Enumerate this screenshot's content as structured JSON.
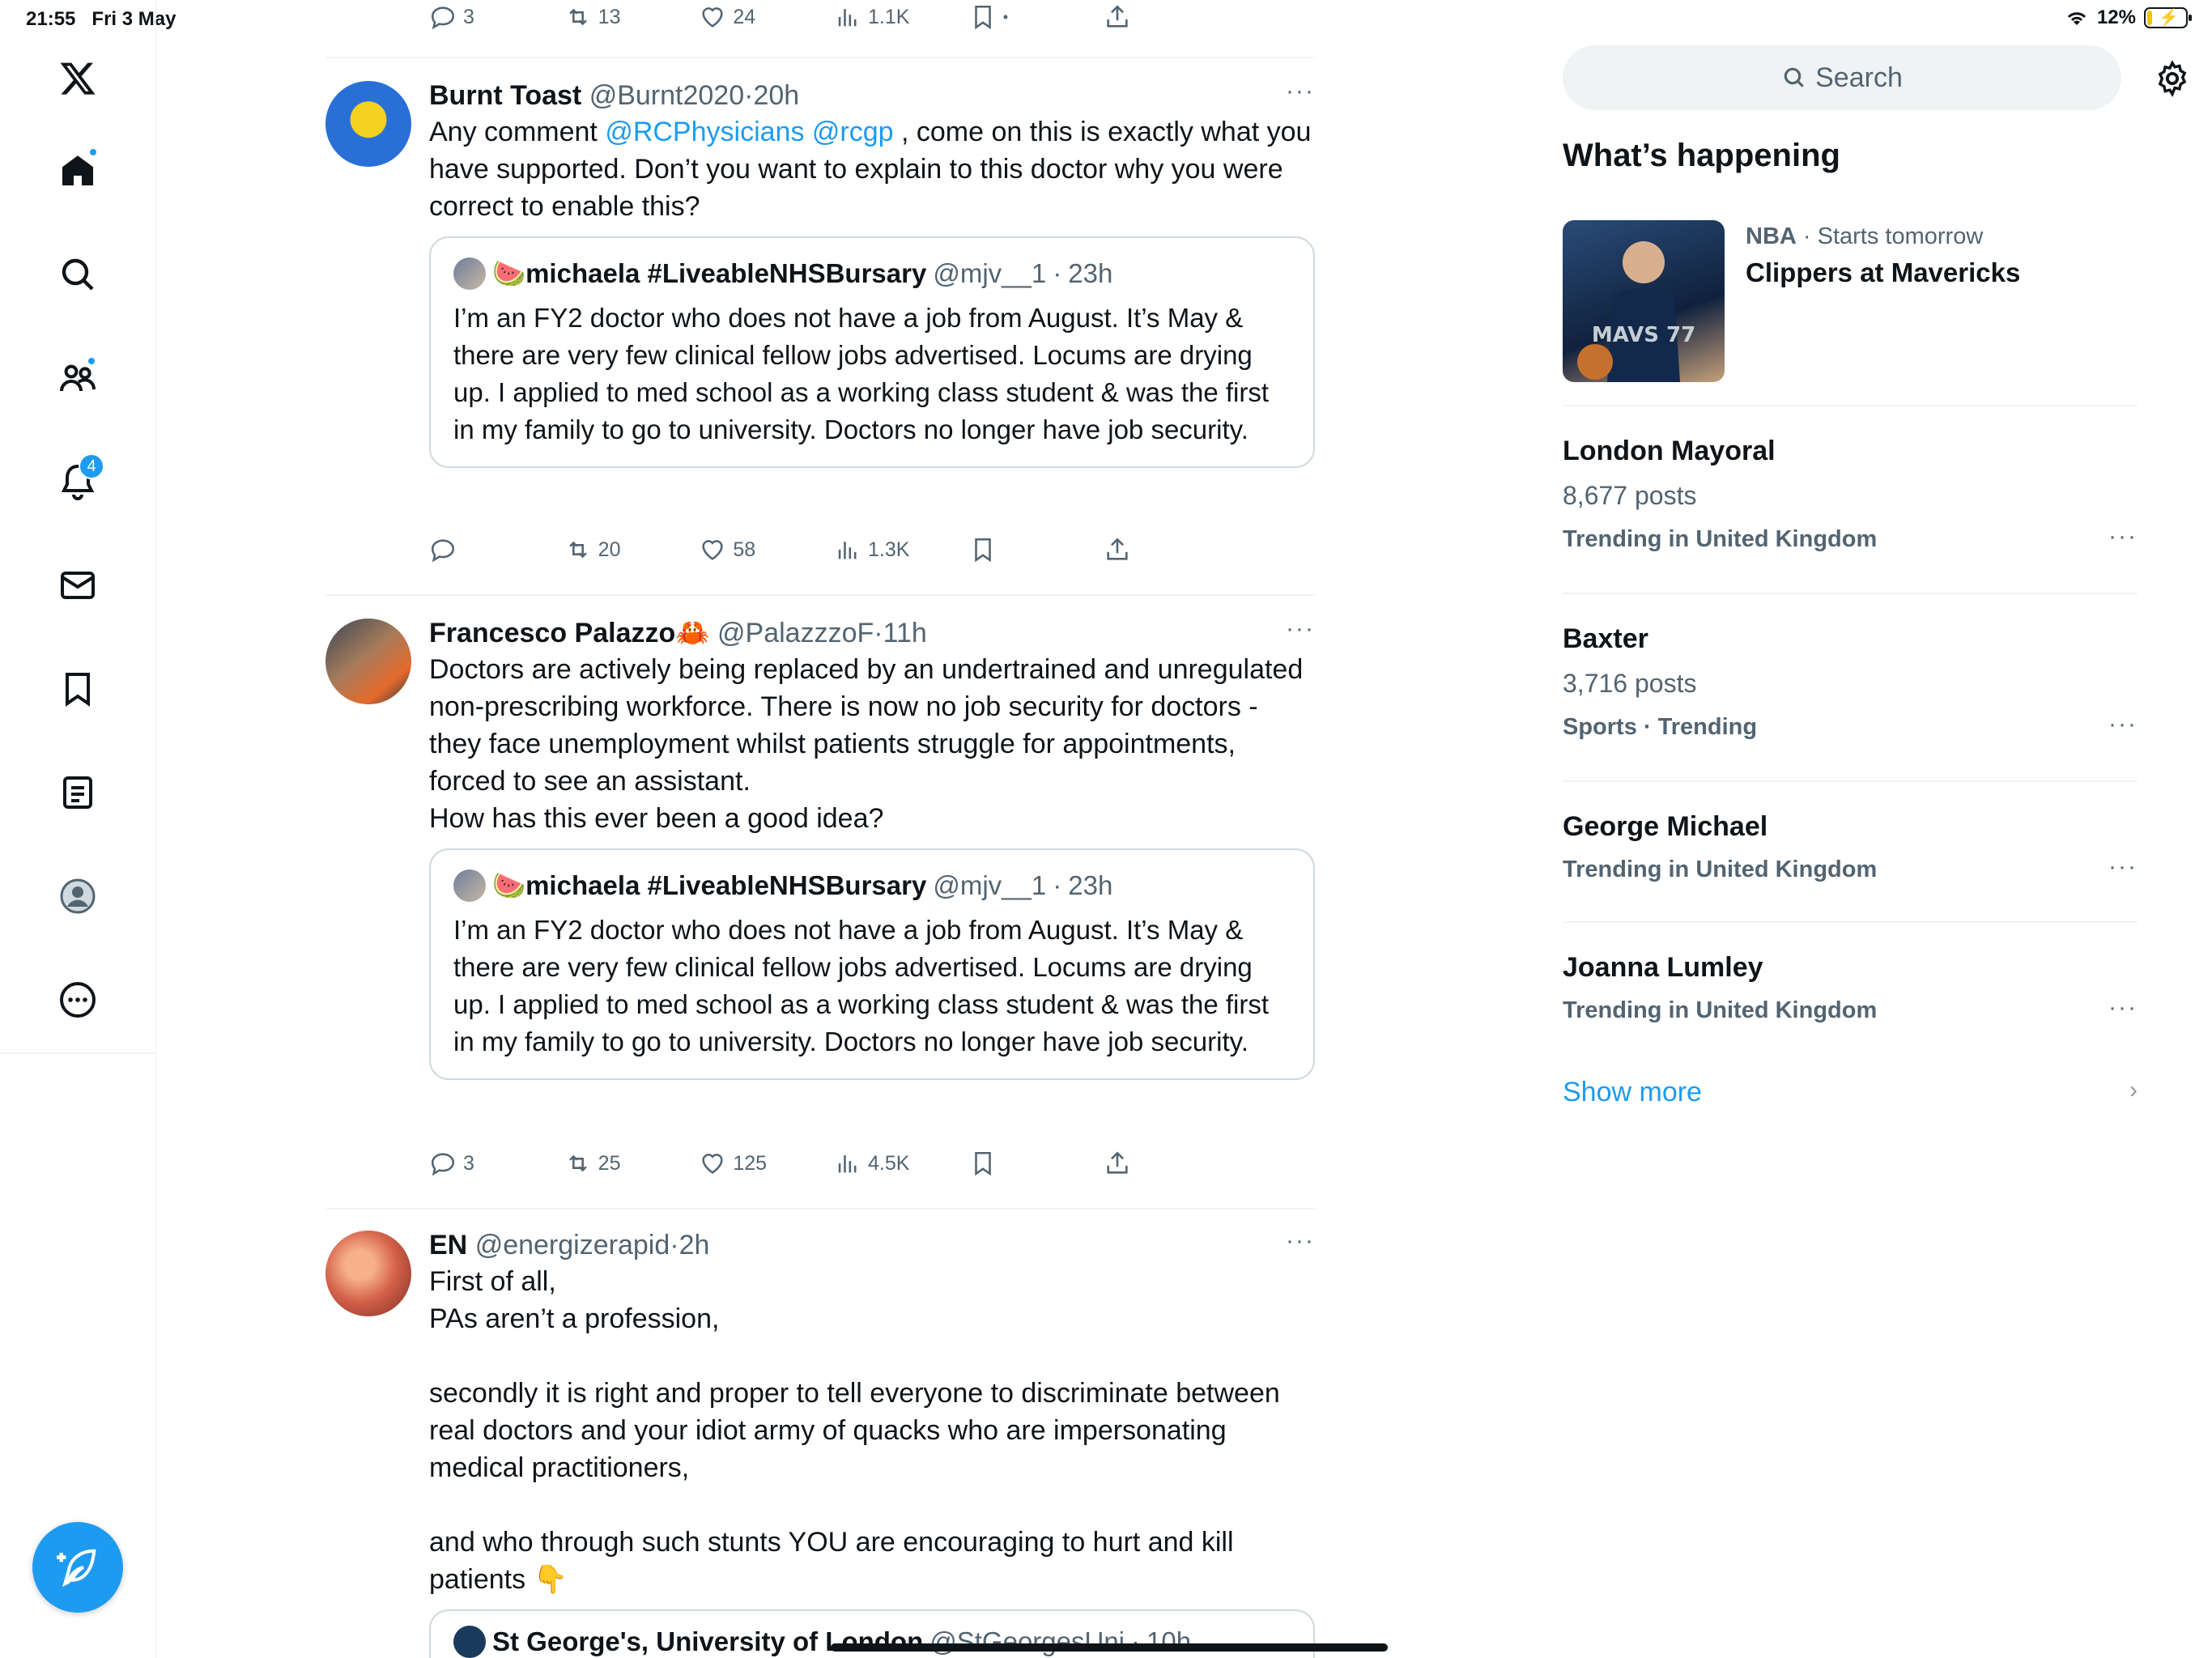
{
  "status_bar": {
    "time": "21:55",
    "date": "Fri 3 May",
    "battery": "12%",
    "battery_level": 0.12
  },
  "nav": {
    "items": [
      {
        "name": "x-logo-icon"
      },
      {
        "name": "home-icon"
      },
      {
        "name": "explore-icon"
      },
      {
        "name": "communities-icon"
      },
      {
        "name": "notifications-icon",
        "badge": "4"
      },
      {
        "name": "messages-icon"
      },
      {
        "name": "bookmarks-icon"
      },
      {
        "name": "lists-icon"
      },
      {
        "name": "profile-icon"
      },
      {
        "name": "more-icon"
      }
    ],
    "compose": "compose-icon"
  },
  "top_actions": {
    "replies": "3",
    "reposts": "13",
    "likes": "24",
    "views": "1.1K"
  },
  "tweets": [
    {
      "display_name": "Burnt Toast",
      "handle": "@Burnt2020",
      "time": "20h",
      "text_before": "Any comment ",
      "mention1": "@RCPhysicians",
      "mention2": "@rcgp",
      "text_after": " , come on this is exactly what you have supported. Don’t you want to explain to this doctor why you were correct to enable this?",
      "quote": {
        "display_name": "🍉michaela #LiveableNHSBursary",
        "handle": "@mjv__1",
        "time": "23h",
        "text": "I’m an FY2 doctor who does not have a job from August. It’s May & there are very few clinical fellow jobs advertised. Locums are drying up. I applied to med school as a working class student & was the first in my family to go to university. Doctors no longer have job security."
      },
      "replies": "",
      "reposts": "20",
      "likes": "58",
      "views": "1.3K"
    },
    {
      "display_name": "Francesco Palazzo🦀",
      "handle": "@PalazzzoF",
      "time": "11h",
      "text": "Doctors are actively being replaced by an undertrained and unregulated non-prescribing workforce. There is now no job security for doctors - they face unemployment whilst patients struggle for appointments, forced to see an assistant.\nHow has this ever been a good idea?",
      "quote": {
        "display_name": "🍉michaela #LiveableNHSBursary",
        "handle": "@mjv__1",
        "time": "23h",
        "text": "I’m an FY2 doctor who does not have a job from August. It’s May & there are very few clinical fellow jobs advertised. Locums are drying up. I applied to med school as a working class student & was the first in my family to go to university. Doctors no longer have job security."
      },
      "replies": "3",
      "reposts": "25",
      "likes": "125",
      "views": "4.5K"
    },
    {
      "display_name": "EN",
      "handle": "@energizerapid",
      "time": "2h",
      "text": "First of all,\nPAs aren’t a profession,\n\nsecondly it is right and proper to tell everyone to discriminate between real doctors and your idiot army of quacks who are impersonating medical practitioners,\n\nand who through such stunts YOU are encouraging to hurt and kill patients 👇",
      "quote": {
        "display_name": "St George's, University of London",
        "handle": "@StGeorgesUni",
        "time": "10h"
      }
    }
  ],
  "sidebar": {
    "search_placeholder": "Search",
    "title": "What’s happening",
    "event": {
      "league": "NBA",
      "sep": " · ",
      "status": "Starts tomorrow",
      "title": "Clippers at Mavericks",
      "jersey": "MAVS 77"
    },
    "trends": [
      {
        "name": "London Mayoral",
        "posts": "8,677 posts",
        "context": "Trending in United Kingdom"
      },
      {
        "name": "Baxter",
        "posts": "3,716 posts",
        "context": "Sports · Trending"
      },
      {
        "name": "George Michael",
        "context": "Trending in United Kingdom"
      },
      {
        "name": "Joanna Lumley",
        "context": "Trending in United Kingdom"
      }
    ],
    "show_more": "Show more"
  },
  "colors": {
    "accent": "#1d9bf0",
    "text": "#0f1419",
    "muted": "#536471",
    "border": "#eff3f4"
  }
}
